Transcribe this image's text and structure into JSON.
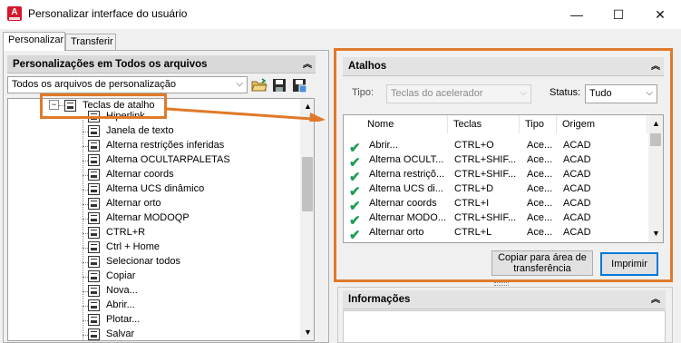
{
  "window": {
    "title": "Personalizar interface do usuário",
    "app_icon_letter": "A",
    "controls": {
      "minimize": "—",
      "maximize": "☐",
      "close": "✕"
    }
  },
  "tabs": [
    {
      "label": "Personalizar",
      "active": true
    },
    {
      "label": "Transferir",
      "active": false
    }
  ],
  "left_panel": {
    "header": "Personalizações em Todos os arquivos",
    "file_filter": "Todos os arquivos de personalização",
    "toolbar_icons": [
      "open-folder-icon",
      "save-icon",
      "save-as-icon"
    ],
    "tree": {
      "parent": "Teclas de atalho",
      "parent_expander": "⊟",
      "items": [
        "Hiperlink...",
        "Janela de texto",
        "Alterna restrições inferidas",
        "Alterna OCULTARPALETAS",
        "Alternar coords",
        "Alterna UCS dinâmico",
        "Alternar orto",
        "Alternar MODOQP",
        "CTRL+R",
        "Ctrl + Home",
        "Selecionar todos",
        "Copiar",
        "Nova...",
        "Abrir...",
        "Plotar...",
        "Salvar"
      ]
    }
  },
  "right_panel": {
    "shortcuts_header": "Atalhos",
    "type_label": "Tipo:",
    "type_value": "Teclas do acelerador",
    "status_label": "Status:",
    "status_value": "Tudo",
    "columns": [
      "Nome",
      "Teclas",
      "Tipo",
      "Origem"
    ],
    "rows": [
      {
        "name": "Abrir...",
        "keys": "CTRL+O",
        "type": "Ace...",
        "origin": "ACAD"
      },
      {
        "name": "Alterna OCULT...",
        "keys": "CTRL+SHIF...",
        "type": "Ace...",
        "origin": "ACAD"
      },
      {
        "name": "Alterna restriçõ...",
        "keys": "CTRL+SHIF...",
        "type": "Ace...",
        "origin": "ACAD"
      },
      {
        "name": "Alterna UCS di...",
        "keys": "CTRL+D",
        "type": "Ace...",
        "origin": "ACAD"
      },
      {
        "name": "Alternar coords",
        "keys": "CTRL+I",
        "type": "Ace...",
        "origin": "ACAD"
      },
      {
        "name": "Alternar MODO...",
        "keys": "CTRL+SHIF...",
        "type": "Ace...",
        "origin": "ACAD"
      },
      {
        "name": "Alternar orto",
        "keys": "CTRL+L",
        "type": "Ace...",
        "origin": "ACAD"
      }
    ],
    "copy_button": "Copiar para área de transferência",
    "print_button": "Imprimir",
    "info_header": "Informações"
  },
  "colors": {
    "highlight": "#e07a2a",
    "check": "#1f9d55",
    "accent": "#0078d7"
  }
}
